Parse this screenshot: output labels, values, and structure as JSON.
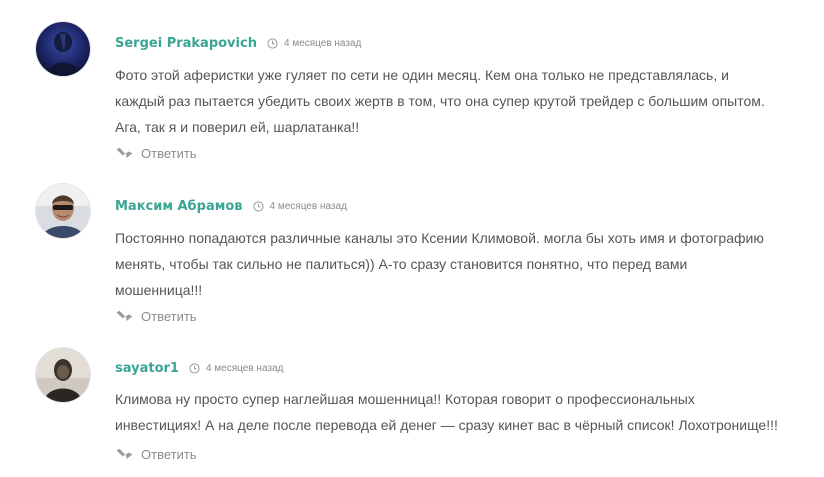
{
  "comments": [
    {
      "author": "Sergei Prakapovich",
      "time": "4 месяцев назад",
      "lines": [
        "Фото этой аферистки уже гуляет по сети не один месяц. Кем она только не представлялась, и",
        "каждый раз пытается убедить своих жертв в том, что она супер крутой трейдер с большим опытом.",
        "Ага, так я и поверил ей, шарлатанка!!"
      ],
      "reply_label": "Ответить"
    },
    {
      "author": "Максим Абрамов",
      "time": "4 месяцев назад",
      "lines": [
        "Постоянно попадаются различные каналы это Ксении Климовой. могла бы хоть имя и фотографию",
        "менять, чтобы так сильно не палиться)) А-то сразу становится понятно, что перед вами",
        "мошенница!!!"
      ],
      "reply_label": "Ответить"
    },
    {
      "author": "sayator1",
      "time": "4 месяцев назад",
      "lines": [
        "Климова ну просто супер наглейшая мошенница!! Которая говорит о профессиональных",
        "инвестициях! А на деле после перевода ей денег — сразу кинет вас в чёрный список! Лохотронище!!!"
      ],
      "reply_label": "Ответить"
    }
  ],
  "colors": {
    "author": "#3aa593",
    "text": "#555555",
    "meta": "#8a8a8a",
    "reply": "#8c8c8c"
  },
  "icons": {
    "time": "clock-icon",
    "reply": "reply-arrow-icon"
  }
}
